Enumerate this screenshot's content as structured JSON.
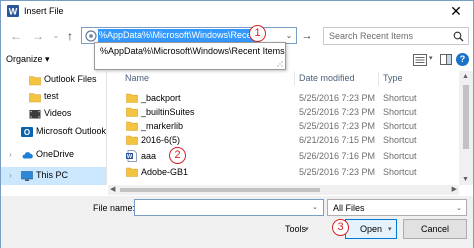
{
  "window": {
    "title": "Insert File",
    "close_glyph": "✕"
  },
  "nav": {
    "back_glyph": "←",
    "forward_glyph": "→",
    "dropdown_glyph": "⌄",
    "up_glyph": "↑",
    "address_text": "%AppData%\\Microsoft\\Windows\\Recent",
    "address_dropdown_glyph": "⌄",
    "go_glyph": "→",
    "search_placeholder": "Search Recent Items"
  },
  "suggestion": {
    "text": "%AppData%\\Microsoft\\Windows\\Recent Items"
  },
  "badges": [
    "1",
    "2",
    "3"
  ],
  "toolbar": {
    "organize": "Organize ▾",
    "view_dropdown_glyph": "▾",
    "help_glyph": "?"
  },
  "sidebar": {
    "items": [
      {
        "label": "Outlook Files",
        "icon": "folder-icon"
      },
      {
        "label": "test",
        "icon": "folder-icon"
      },
      {
        "label": "Videos",
        "icon": "video-folder-icon"
      },
      {
        "label": "Microsoft Outlook",
        "icon": "outlook-icon"
      },
      {
        "label": "OneDrive",
        "icon": "cloud-icon"
      },
      {
        "label": "This PC",
        "icon": "computer-icon",
        "selected": true
      }
    ],
    "chevron_glyph": "›"
  },
  "columns": {
    "name": "Name",
    "date": "Date modified",
    "type": "Type",
    "sort_glyph": "^"
  },
  "files": [
    {
      "name": "_backport",
      "date": "5/25/2016 7:23 PM",
      "type": "Shortcut",
      "icon": "folder-icon"
    },
    {
      "name": "_builtinSuites",
      "date": "5/25/2016 7:23 PM",
      "type": "Shortcut",
      "icon": "folder-icon"
    },
    {
      "name": "_markerlib",
      "date": "5/25/2016 7:23 PM",
      "type": "Shortcut",
      "icon": "folder-icon"
    },
    {
      "name": "2016-6(5)",
      "date": "6/21/2016 7:15 PM",
      "type": "Shortcut",
      "icon": "folder-icon"
    },
    {
      "name": "aaa",
      "date": "5/26/2016 7:16 PM",
      "type": "Shortcut",
      "icon": "word-document-icon"
    },
    {
      "name": "Adobe-GB1",
      "date": "5/25/2016 7:23 PM",
      "type": "Shortcut",
      "icon": "folder-icon"
    }
  ],
  "scroll": {
    "up": "▲",
    "down": "▼",
    "left": "◀",
    "right": "▶"
  },
  "bottom": {
    "file_name_label": "File name:",
    "file_name_value": "",
    "file_name_dropdown_glyph": "⌄",
    "filter_value": "All Files",
    "filter_dropdown_glyph": "⌄",
    "tools_label": "Tools",
    "tools_dropdown_glyph": "▾",
    "open_label": "Open",
    "open_dropdown_glyph": "▾",
    "cancel_label": "Cancel"
  },
  "colors": {
    "accent": "#0078d7",
    "selection": "#3399ff",
    "badge": "#d3242a",
    "folder": "#f5c342"
  }
}
